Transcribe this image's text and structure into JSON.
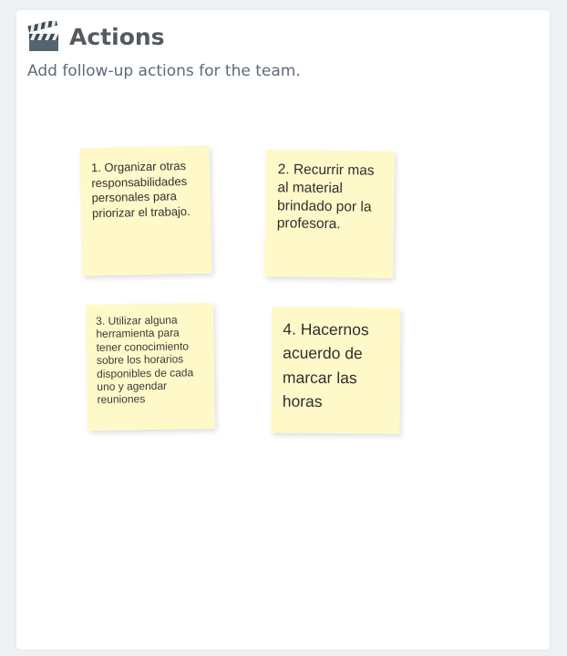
{
  "header": {
    "icon": "clapperboard-icon",
    "title": "Actions",
    "subtitle": "Add follow-up actions for the team."
  },
  "notes": [
    {
      "text": "1. Organizar otras responsabilidades personales para priorizar el trabajo."
    },
    {
      "text": "2. Recurrir mas al material brindado por la profesora."
    },
    {
      "text": "3. Utilizar alguna herramienta para tener conocimiento sobre los horarios disponibles de cada uno y agendar reuniones"
    },
    {
      "text": "4. Hacernos acuerdo de marcar las horas"
    }
  ],
  "colors": {
    "note_background": "#fff9c9",
    "page_background": "#eef1f4",
    "title": "#555a5f",
    "subtitle": "#5c6b7a"
  }
}
